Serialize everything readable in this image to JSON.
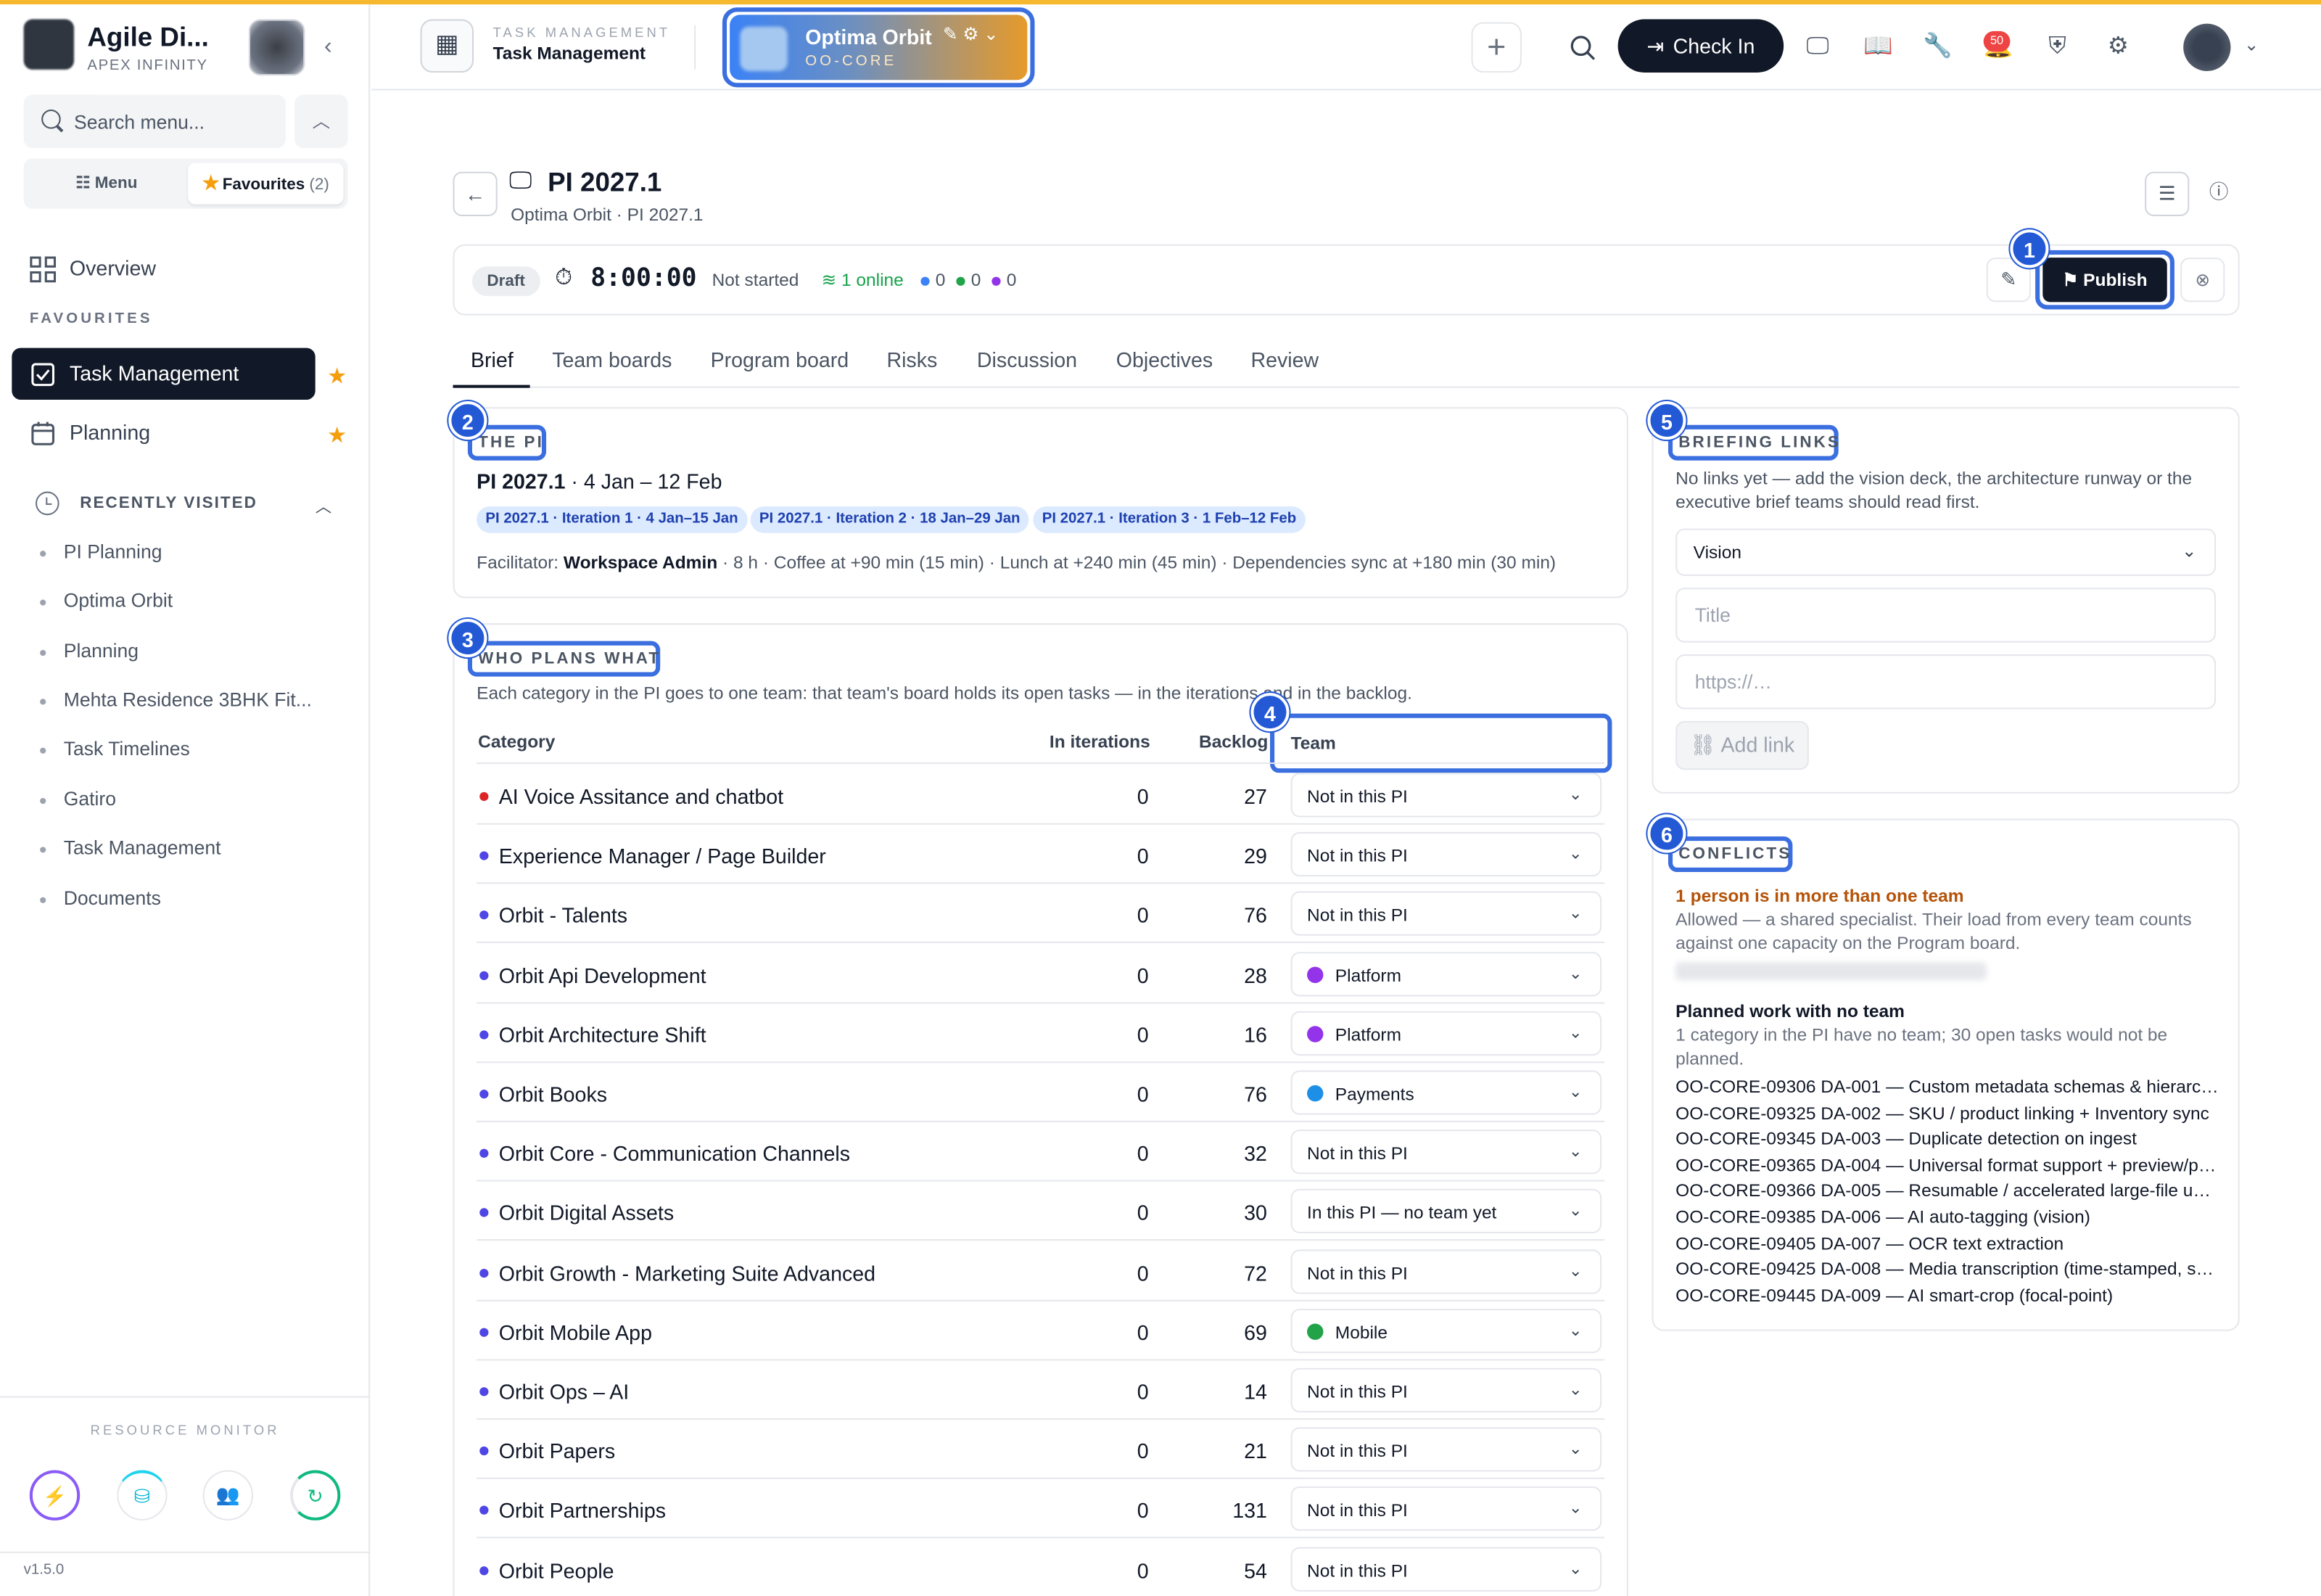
{
  "sidebar": {
    "brand_title": "Agile Di...",
    "brand_sub": "APEX INFINITY",
    "search_placeholder": "Search menu...",
    "seg_menu": "Menu",
    "seg_favourites": "Favourites",
    "seg_fav_count": "(2)",
    "overview": "Overview",
    "favourites_label": "FAVOURITES",
    "fav_items": [
      "Task Management",
      "Planning"
    ],
    "recently_visited_label": "RECENTLY VISITED",
    "recent_items": [
      "PI Planning",
      "Optima Orbit",
      "Planning",
      "Mehta Residence 3BHK Fit...",
      "Task Timelines",
      "Gatiro",
      "Task Management",
      "Documents"
    ],
    "resource_monitor_label": "RESOURCE MONITOR",
    "version": "v1.5.0"
  },
  "header": {
    "kicker": "TASK MANAGEMENT",
    "title": "Task Management",
    "project_name": "Optima Orbit",
    "project_code": "OO-CORE",
    "checkin_label": "Check In",
    "notif_count": "50"
  },
  "pi": {
    "title": "PI 2027.1",
    "crumbs": "Optima Orbit · PI 2027.1",
    "status": "Draft",
    "timer": "8:00:00",
    "timer_status": "Not started",
    "online": "1 online",
    "presence": [
      {
        "count": "0",
        "color": "#3b82f6"
      },
      {
        "count": "0",
        "color": "#22a34a"
      },
      {
        "count": "0",
        "color": "#9333ea"
      }
    ],
    "publish_label": "Publish"
  },
  "tabs": [
    "Brief",
    "Team boards",
    "Program board",
    "Risks",
    "Discussion",
    "Objectives",
    "Review"
  ],
  "callouts": [
    "1",
    "2",
    "3",
    "4",
    "5",
    "6"
  ],
  "the_pi": {
    "heading": "THE PI",
    "name": "PI 2027.1",
    "dates": " · 4 Jan – 12 Feb",
    "iterations": [
      "PI 2027.1 · Iteration 1 · 4 Jan–15 Jan",
      "PI 2027.1 · Iteration 2 · 18 Jan–29 Jan",
      "PI 2027.1 · Iteration 3 · 1 Feb–12 Feb"
    ],
    "facilitator_label": "Facilitator: ",
    "facilitator_name": "Workspace Admin",
    "facilitator_rest": " · 8 h · Coffee at +90 min (15 min) · Lunch at +240 min (45 min) · Dependencies sync at +180 min (30 min)"
  },
  "who_plans": {
    "heading": "WHO PLANS WHAT",
    "description": "Each category in the PI goes to one team: that team's board holds its open tasks — in the iterations and in the backlog.",
    "columns": {
      "category": "Category",
      "iterations": "In iterations",
      "backlog": "Backlog",
      "team": "Team"
    },
    "rows": [
      {
        "category": "AI Voice Assitance and chatbot",
        "dot": "#dc2626",
        "iterations": "0",
        "backlog": "27",
        "team": "Not in this PI",
        "team_color": ""
      },
      {
        "category": "Experience Manager / Page Builder",
        "dot": "#4f46e5",
        "iterations": "0",
        "backlog": "29",
        "team": "Not in this PI",
        "team_color": ""
      },
      {
        "category": "Orbit - Talents",
        "dot": "#4f46e5",
        "iterations": "0",
        "backlog": "76",
        "team": "Not in this PI",
        "team_color": ""
      },
      {
        "category": "Orbit Api Development",
        "dot": "#4f46e5",
        "iterations": "0",
        "backlog": "28",
        "team": "Platform",
        "team_color": "#9333ea"
      },
      {
        "category": "Orbit Architecture Shift",
        "dot": "#4f46e5",
        "iterations": "0",
        "backlog": "16",
        "team": "Platform",
        "team_color": "#9333ea"
      },
      {
        "category": "Orbit Books",
        "dot": "#4f46e5",
        "iterations": "0",
        "backlog": "76",
        "team": "Payments",
        "team_color": "#1d8fe6"
      },
      {
        "category": "Orbit Core - Communication Channels",
        "dot": "#4f46e5",
        "iterations": "0",
        "backlog": "32",
        "team": "Not in this PI",
        "team_color": ""
      },
      {
        "category": "Orbit Digital Assets",
        "dot": "#4f46e5",
        "iterations": "0",
        "backlog": "30",
        "team": "In this PI — no team yet",
        "team_color": ""
      },
      {
        "category": "Orbit Growth - Marketing Suite Advanced",
        "dot": "#4f46e5",
        "iterations": "0",
        "backlog": "72",
        "team": "Not in this PI",
        "team_color": ""
      },
      {
        "category": "Orbit Mobile App",
        "dot": "#4f46e5",
        "iterations": "0",
        "backlog": "69",
        "team": "Mobile",
        "team_color": "#22a34a"
      },
      {
        "category": "Orbit Ops – AI",
        "dot": "#4f46e5",
        "iterations": "0",
        "backlog": "14",
        "team": "Not in this PI",
        "team_color": ""
      },
      {
        "category": "Orbit Papers",
        "dot": "#4f46e5",
        "iterations": "0",
        "backlog": "21",
        "team": "Not in this PI",
        "team_color": ""
      },
      {
        "category": "Orbit Partnerships",
        "dot": "#4f46e5",
        "iterations": "0",
        "backlog": "131",
        "team": "Not in this PI",
        "team_color": ""
      },
      {
        "category": "Orbit People",
        "dot": "#4f46e5",
        "iterations": "0",
        "backlog": "54",
        "team": "Not in this PI",
        "team_color": ""
      }
    ]
  },
  "briefing_links": {
    "heading": "BRIEFING LINKS",
    "description": "No links yet — add the vision deck, the architecture runway or the executive brief teams should read first.",
    "type_value": "Vision",
    "title_placeholder": "Title",
    "url_placeholder": "https://…",
    "add_label": "Add link"
  },
  "conflicts": {
    "heading": "CONFLICTS",
    "warning": "1 person is in more than one team",
    "warning_desc": "Allowed — a shared specialist. Their load from every team counts against one capacity on the Program board.",
    "planned_title": "Planned work with no team",
    "planned_desc": "1 category in the PI have no team; 30 open tasks would not be planned.",
    "items": [
      "OO-CORE-09306 DA-001 — Custom metadata schemas & hierarchical taxonomies",
      "OO-CORE-09325 DA-002 — SKU / product linking + Inventory sync",
      "OO-CORE-09345 DA-003 — Duplicate detection on ingest",
      "OO-CORE-09365 DA-004 — Universal format support + preview/previews",
      "OO-CORE-09366 DA-005 — Resumable / accelerated large-file uploads",
      "OO-CORE-09385 DA-006 — AI auto-tagging (vision)",
      "OO-CORE-09405 DA-007 — OCR text extraction",
      "OO-CORE-09425 DA-008 — Media transcription (time-stamped, searchable)",
      "OO-CORE-09445 DA-009 — AI smart-crop (focal-point)"
    ]
  }
}
